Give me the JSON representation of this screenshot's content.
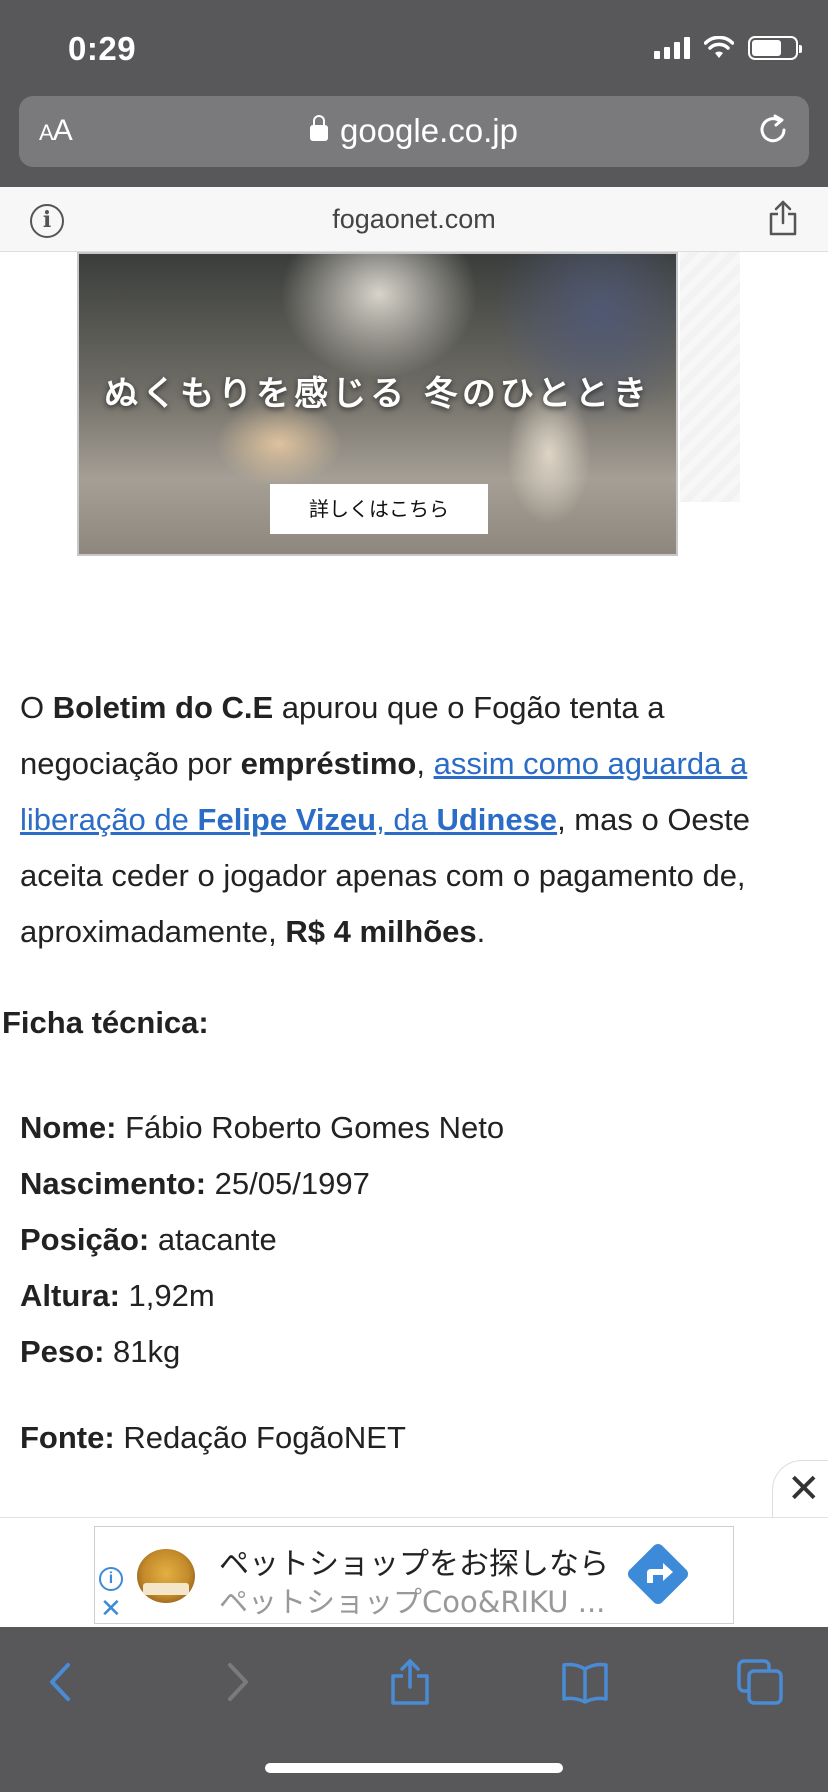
{
  "status_bar": {
    "time": "0:29"
  },
  "browser": {
    "text_size_label": "AA",
    "url": "google.co.jp",
    "site_domain": "fogaonet.com"
  },
  "ad_banner": {
    "headline": "ぬくもりを感じる 冬のひととき",
    "cta": "詳しくはこちら"
  },
  "article": {
    "p1_o": "O ",
    "p1_boletim": "Boletim do C.E",
    "p1_a": " apurou que o Fogão tenta a negociação por ",
    "p1_emprestimo": "empréstimo",
    "p1_comma": ", ",
    "link_a": "assim como aguarda a liberação de ",
    "link_felipe": "Felipe Vizeu",
    "link_b": ", da ",
    "link_udinese": "Udinese",
    "p1_b": ", mas o Oeste aceita ceder o jogador apenas com o pagamento de, aproximadamente, ",
    "p1_valor": "R$ 4 milhões",
    "p1_end": "."
  },
  "ficha": {
    "title": "Ficha técnica:",
    "rows": [
      {
        "label": "Nome:",
        "value": " Fábio Roberto Gomes Neto"
      },
      {
        "label": "Nascimento:",
        "value": " 25/05/1997"
      },
      {
        "label": "Posição:",
        "value": " atacante"
      },
      {
        "label": "Altura:",
        "value": " 1,92m"
      },
      {
        "label": "Peso:",
        "value": " 81kg"
      }
    ]
  },
  "fonte": {
    "label": "Fonte:",
    "value": " Redação FogãoNET"
  },
  "bottom_ad": {
    "title": "ペットショップをお探しなら",
    "subtitle": "ペットショップCoo&RIKU ...",
    "brand_color": "#3d8bd8"
  },
  "icons": {
    "ad_close": "close-icon",
    "ad_info": "info-icon",
    "toolbar": [
      "back-icon",
      "forward-icon",
      "share-icon",
      "bookmarks-icon",
      "tabs-icon"
    ]
  }
}
